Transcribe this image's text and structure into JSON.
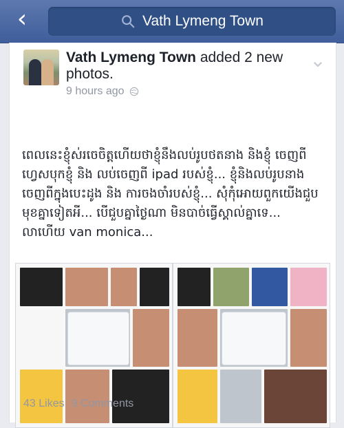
{
  "search": {
    "text": "Vath Lymeng Town"
  },
  "post": {
    "author": "Vath Lymeng Town",
    "action": " added 2 new",
    "action_line2": "photos.",
    "time": "9 hours ago",
    "caption": "ពេលនេះខ្ញុំស់រចេចិត្តហើយថាខ្ញុំនឹងលប់រូបថតនាង និងខ្ញុំ ចេញពីហ្វេសបុកខ្ញុំ និង លប់ចេញពី ipad របស់ខ្ញុំ... ខ្ញុំនិងលប់រូបនាងចេញពីក្នុងបេះដូង និង ការចងចាំរបស់ខ្ញុំ... សុំកុំអោយពួកយើងជួបមុខគ្នាទៀតអី... បើជួបគ្នាថៃ្ងណា មិនបាច់ធ្វើស្គាល់គ្នាទេ... លាហើយ van monica...",
    "likes": "43 Likes",
    "comments": "9 Comments"
  },
  "icons": {
    "back": "back-chevron-icon",
    "search": "search-icon",
    "privacy": "globe-icon",
    "options": "chevron-down-icon"
  }
}
